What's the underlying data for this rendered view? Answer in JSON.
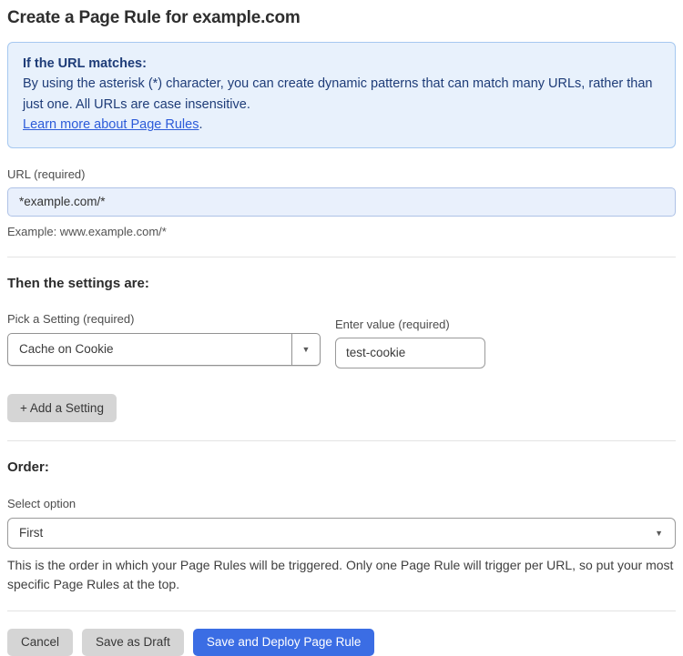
{
  "page": {
    "title": "Create a Page Rule for example.com"
  },
  "info_box": {
    "heading": "If the URL matches:",
    "body": "By using the asterisk (*) character, you can create dynamic patterns that can match many URLs, rather than just one. All URLs are case insensitive.",
    "link_label": "Learn more about Page Rules",
    "link_suffix": "."
  },
  "url_field": {
    "label": "URL (required)",
    "value": "*example.com/*",
    "helper": "Example: www.example.com/*"
  },
  "settings": {
    "heading": "Then the settings are:",
    "setting_select": {
      "label": "Pick a Setting (required)",
      "value": "Cache on Cookie"
    },
    "value_input": {
      "label": "Enter value (required)",
      "value": "test-cookie"
    },
    "add_button_label": "+ Add a Setting"
  },
  "order": {
    "heading": "Order:",
    "select_label": "Select option",
    "selected_option": "First",
    "helper": "This is the order in which your Page Rules will be triggered. Only one Page Rule will trigger per URL, so put your most specific Page Rules at the top."
  },
  "footer": {
    "cancel_label": "Cancel",
    "save_draft_label": "Save as Draft",
    "save_deploy_label": "Save and Deploy Page Rule"
  },
  "icons": {
    "dropdown_arrow": "▼"
  },
  "colors": {
    "accent_blue": "#3b6de4",
    "info_box_bg": "#e8f1fc",
    "info_box_border": "#a6c8f0",
    "info_text": "#1e3c78",
    "link_blue": "#2c5bd9",
    "highlight_input_bg": "#e9f0fc",
    "gray_button_bg": "#d5d5d5"
  }
}
